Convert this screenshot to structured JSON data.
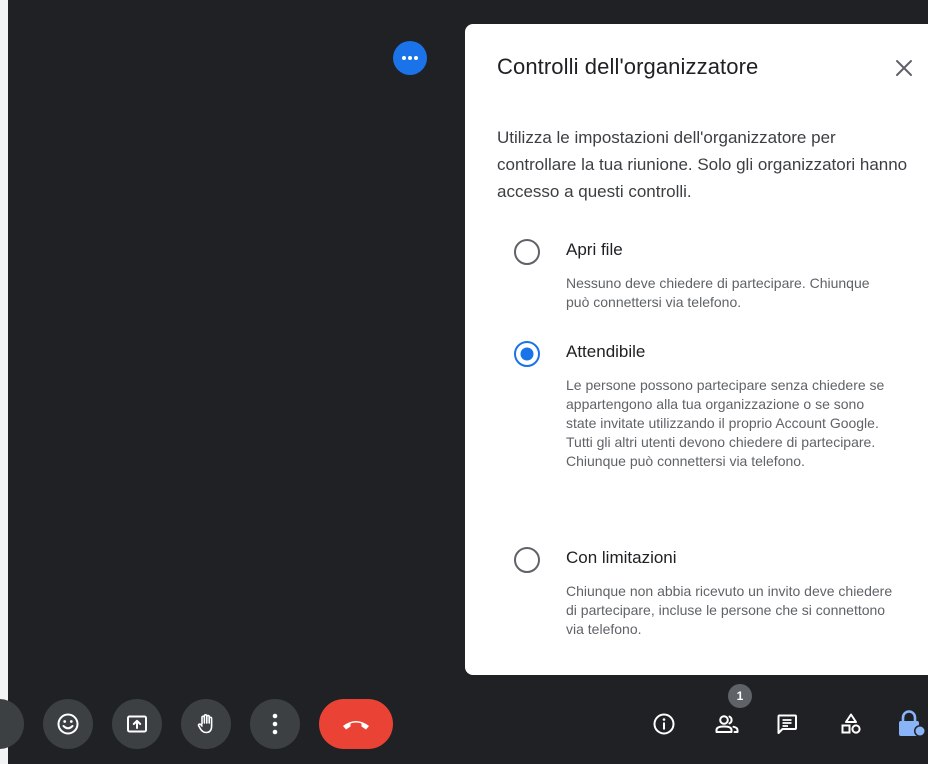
{
  "panel": {
    "title": "Controlli dell'organizzatore",
    "intro": "Utilizza le impostazioni dell'organizzatore per controllare la tua riunione. Solo gli organizzatori hanno accesso a questi controlli.",
    "options": [
      {
        "label": "Apri file",
        "description": "Nessuno deve chiedere di partecipare. Chiunque può connettersi via telefono.",
        "selected": false
      },
      {
        "label": "Attendibile",
        "description": "Le persone possono partecipare senza chiedere se appartengono alla tua organizzazione o se sono state invitate utilizzando il proprio Account Google. Tutti gli altri utenti devono chiedere di partecipare. Chiunque può connettersi via telefono.",
        "selected": true
      },
      {
        "label": "Con limitazioni",
        "description": "Chiunque non abbia ricevuto un invito deve chiedere di partecipare, incluse le persone che si connettono via telefono.",
        "selected": false
      }
    ]
  },
  "toolbar": {
    "participants_count": "1"
  },
  "colors": {
    "background": "#202124",
    "accent": "#1a73e8",
    "end_call": "#ea4335",
    "control_bg": "#3c4043"
  }
}
